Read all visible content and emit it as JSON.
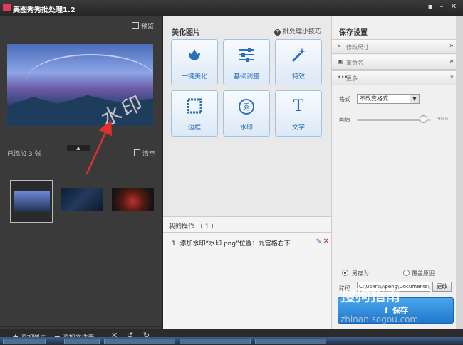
{
  "window": {
    "title": "美图秀秀批处理1.2"
  },
  "left": {
    "preview_label": "预览",
    "watermark_text": "水印",
    "added_count": "已添加 3 张",
    "clear_label": "清空",
    "bottom": {
      "add_image": "添加图片",
      "add_folder": "添加文件夹"
    }
  },
  "mid": {
    "title": "美化图片",
    "tips": "批处理小技巧",
    "tools": [
      {
        "label": "一键美化",
        "icon": "tulip-icon"
      },
      {
        "label": "基础调整",
        "icon": "sliders-icon"
      },
      {
        "label": "特效",
        "icon": "magic-wand-icon"
      },
      {
        "label": "边框",
        "icon": "frame-icon"
      },
      {
        "label": "水印",
        "icon": "watermark-icon",
        "glyph": "秀"
      },
      {
        "label": "文字",
        "icon": "text-icon",
        "glyph": "T"
      }
    ],
    "ops": {
      "title": "我的操作 （ 1 ）",
      "items": [
        "1 .添加水印“水印.png”位置：九宫格右下"
      ]
    }
  },
  "right": {
    "title": "保存设置",
    "sections": [
      {
        "label": "修改尺寸",
        "icon": "crop-icon"
      },
      {
        "label": "重命名",
        "icon": "rename-icon"
      },
      {
        "label": "更多",
        "icon": "more-icon"
      }
    ],
    "format_label": "格式",
    "format_value": "不改变格式",
    "quality_label": "画质",
    "quality_value": "90%",
    "quality_level": 0.9,
    "save_as_label": "另存为",
    "overwrite_label": "覆盖原图",
    "path_label": "路径",
    "path_value": "C:\\Users\\Apeng\\Documents\\",
    "change_label": "更改",
    "save_label": "保存"
  },
  "site_watermark": {
    "line1": "搜狗指南",
    "line2": "zhinan.sogou.com"
  },
  "colors": {
    "accent": "#2a6fb8",
    "save_button": "#2f8ee0",
    "arrow": "#e03030",
    "delete": "#c01818"
  }
}
